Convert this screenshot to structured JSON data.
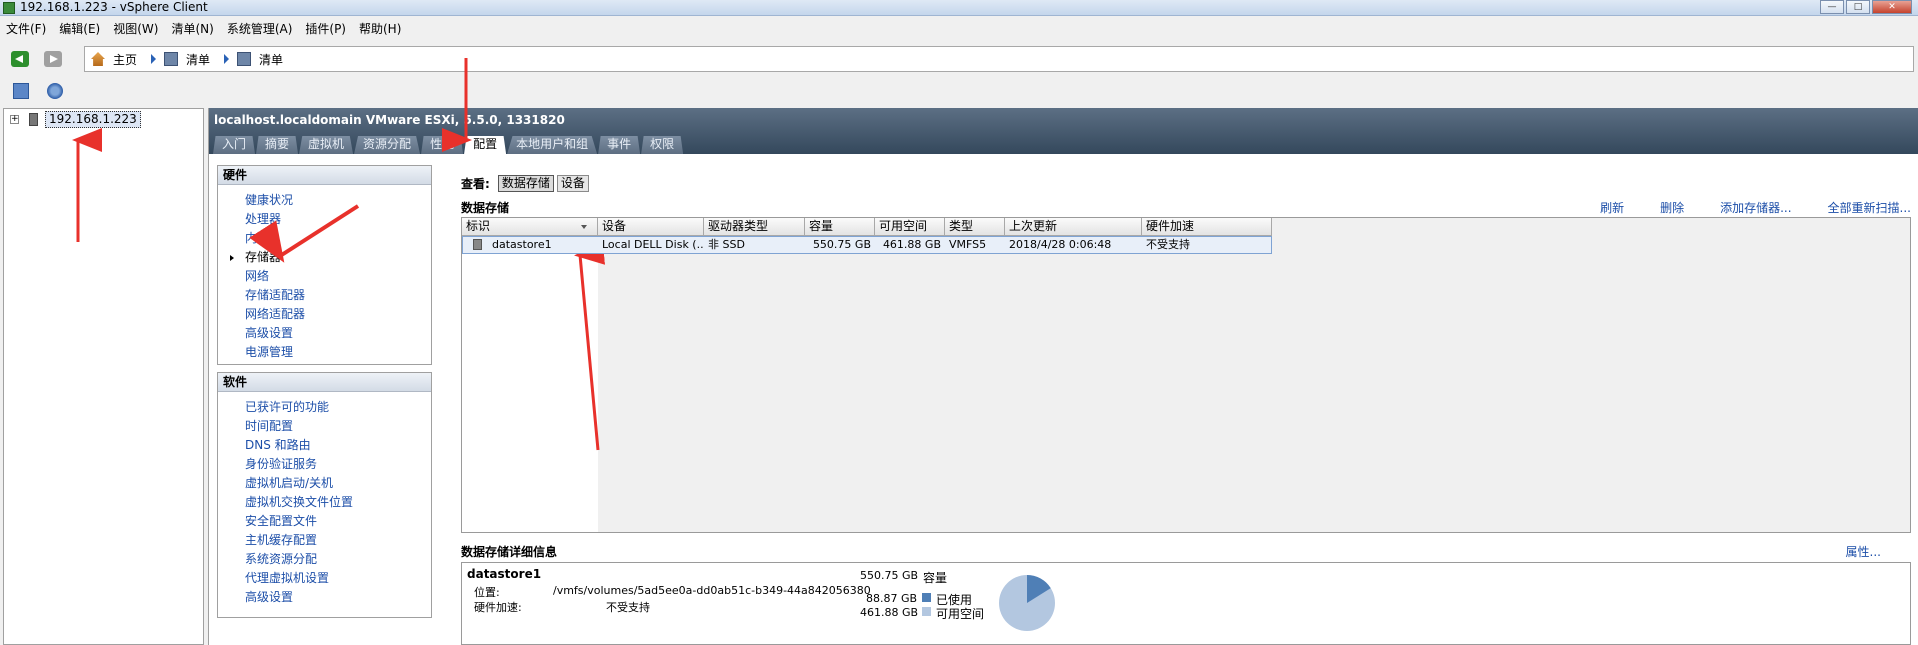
{
  "window": {
    "title": "192.168.1.223 - vSphere Client"
  },
  "menu": [
    "文件(F)",
    "编辑(E)",
    "视图(W)",
    "清单(N)",
    "系统管理(A)",
    "插件(P)",
    "帮助(H)"
  ],
  "breadcrumb": {
    "home": "主页",
    "items": [
      "清单",
      "清单"
    ]
  },
  "tree": {
    "host": "192.168.1.223"
  },
  "host_header": {
    "title": "localhost.localdomain VMware ESXi, 5.5.0, 1331820"
  },
  "tabs": [
    "入门",
    "摘要",
    "虚拟机",
    "资源分配",
    "性能",
    "配置",
    "本地用户和组",
    "事件",
    "权限"
  ],
  "active_tab": "配置",
  "hardware": {
    "title": "硬件",
    "items": [
      "健康状况",
      "处理器",
      "内存",
      "存储器",
      "网络",
      "存储适配器",
      "网络适配器",
      "高级设置",
      "电源管理"
    ],
    "selected": "存储器"
  },
  "software": {
    "title": "软件",
    "items": [
      "已获许可的功能",
      "时间配置",
      "DNS 和路由",
      "身份验证服务",
      "虚拟机启动/关机",
      "虚拟机交换文件位置",
      "安全配置文件",
      "主机缓存配置",
      "系统资源分配",
      "代理虚拟机设置",
      "高级设置"
    ]
  },
  "view": {
    "label": "查看:",
    "options": [
      "数据存储",
      "设备"
    ],
    "selected": "数据存储"
  },
  "datastores": {
    "title": "数据存储",
    "actions": [
      "刷新",
      "删除",
      "添加存储器...",
      "全部重新扫描..."
    ],
    "columns": [
      "标识",
      "设备",
      "驱动器类型",
      "容量",
      "可用空间",
      "类型",
      "上次更新",
      "硬件加速"
    ],
    "rows": [
      {
        "id": "datastore1",
        "device": "Local DELL Disk (...",
        "drive_type": "非 SSD",
        "capacity": "550.75 GB",
        "free": "461.88 GB",
        "type": "VMFS5",
        "updated": "2018/4/28 0:06:48",
        "hw_accel": "不受支持"
      }
    ]
  },
  "details": {
    "title": "数据存储详细信息",
    "properties_link": "属性...",
    "name": "datastore1",
    "location_label": "位置:",
    "location": "/vmfs/volumes/5ad5ee0a-dd0ab51c-b349-44a842056380",
    "hw_accel_label": "硬件加速:",
    "hw_accel": "不受支持",
    "capacity_value": "550.75 GB",
    "capacity_label": "容量",
    "used_value": "88.87 GB",
    "used_label": "已使用",
    "free_value": "461.88 GB",
    "free_label": "可用空间",
    "used_fraction": 0.161,
    "colors": {
      "used": "#4f7fb6",
      "free": "#b3c7e0"
    }
  }
}
